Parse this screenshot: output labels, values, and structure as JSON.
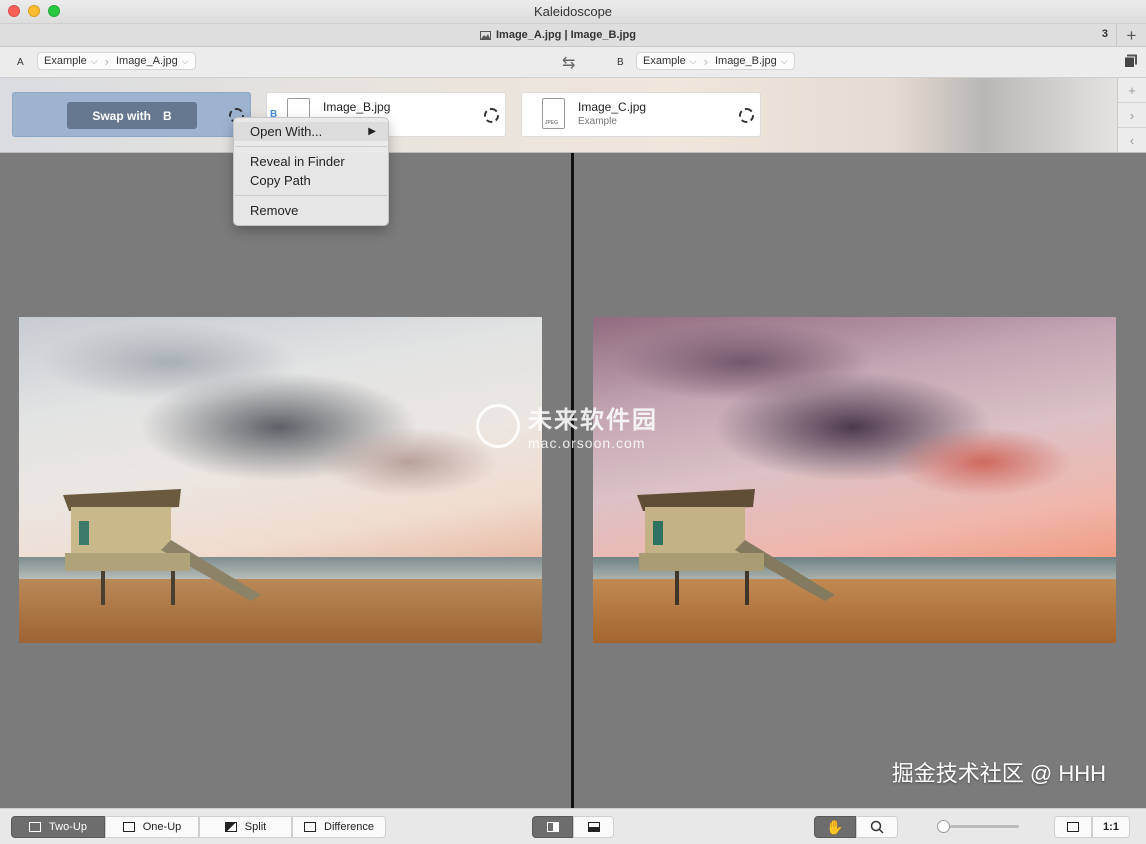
{
  "window": {
    "title": "Kaleidoscope",
    "lights": [
      "#fd5f57",
      "#febd2e",
      "#28c840"
    ]
  },
  "tab": {
    "title": "Image_A.jpg | Image_B.jpg",
    "count": "3",
    "plus": "+"
  },
  "path": {
    "a_label": "A",
    "a_folder": "Example",
    "a_file": "Image_A.jpg",
    "b_label": "B",
    "b_folder": "Example",
    "b_file": "Image_B.jpg",
    "swap_icon": "⇆"
  },
  "files": {
    "swap_label": "Swap with",
    "swap_target": "B",
    "b_badge": "B",
    "b_name": "Image_B.jpg",
    "c_name": "Image_C.jpg",
    "c_sub": "Example"
  },
  "sidebar_buttons": [
    "+",
    "›",
    "‹"
  ],
  "context_menu": {
    "items": [
      "Open With...",
      "Reveal in Finder",
      "Copy Path",
      "Remove"
    ],
    "arrow": "▶"
  },
  "watermark": {
    "cn": "未来软件园",
    "url": "mac.orsoon.com"
  },
  "corner_text": "掘金技术社区 @ HHH",
  "toolbar": {
    "modes": [
      "Two-Up",
      "One-Up",
      "Split",
      "Difference"
    ],
    "active_mode": "Two-Up",
    "fit_label": "1:1"
  }
}
